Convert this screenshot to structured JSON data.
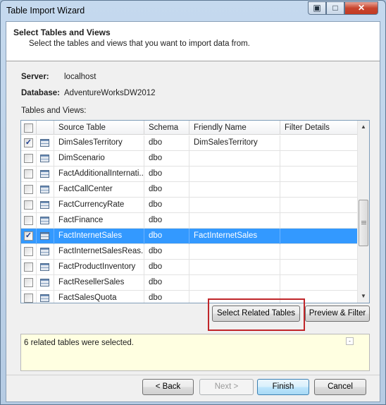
{
  "window": {
    "title": "Table Import Wizard",
    "controls": {
      "help": "▣",
      "maximize": "□",
      "close": "✕"
    }
  },
  "header": {
    "title": "Select Tables and Views",
    "subtitle": "Select the tables and views that you want to import data from."
  },
  "info": {
    "server_label": "Server:",
    "server_value": "localhost",
    "database_label": "Database:",
    "database_value": "AdventureWorksDW2012",
    "tables_label": "Tables and Views:"
  },
  "grid": {
    "columns": [
      "",
      "",
      "Source Table",
      "Schema",
      "Friendly Name",
      "Filter Details"
    ],
    "rows": [
      {
        "checked": true,
        "source": "DimSalesTerritory",
        "schema": "dbo",
        "friendly": "DimSalesTerritory",
        "filter": "",
        "selected": false
      },
      {
        "checked": false,
        "source": "DimScenario",
        "schema": "dbo",
        "friendly": "",
        "filter": "",
        "selected": false
      },
      {
        "checked": false,
        "source": "FactAdditionalInternati...",
        "schema": "dbo",
        "friendly": "",
        "filter": "",
        "selected": false
      },
      {
        "checked": false,
        "source": "FactCallCenter",
        "schema": "dbo",
        "friendly": "",
        "filter": "",
        "selected": false
      },
      {
        "checked": false,
        "source": "FactCurrencyRate",
        "schema": "dbo",
        "friendly": "",
        "filter": "",
        "selected": false
      },
      {
        "checked": false,
        "source": "FactFinance",
        "schema": "dbo",
        "friendly": "",
        "filter": "",
        "selected": false
      },
      {
        "checked": true,
        "source": "FactInternetSales",
        "schema": "dbo",
        "friendly": "FactInternetSales",
        "filter": "",
        "selected": true
      },
      {
        "checked": false,
        "source": "FactInternetSalesReas...",
        "schema": "dbo",
        "friendly": "",
        "filter": "",
        "selected": false
      },
      {
        "checked": false,
        "source": "FactProductInventory",
        "schema": "dbo",
        "friendly": "",
        "filter": "",
        "selected": false
      },
      {
        "checked": false,
        "source": "FactResellerSales",
        "schema": "dbo",
        "friendly": "",
        "filter": "",
        "selected": false
      },
      {
        "checked": false,
        "source": "FactSalesQuota",
        "schema": "dbo",
        "friendly": "",
        "filter": "",
        "selected": false
      }
    ],
    "scroll": {
      "up": "▲",
      "down": "▼"
    }
  },
  "actions": {
    "select_related": "Select Related Tables",
    "preview_filter": "Preview & Filter"
  },
  "status": {
    "message": "6 related tables were selected.",
    "scroll_glyph": "-"
  },
  "footer": {
    "back": "< Back",
    "next": "Next >",
    "finish": "Finish",
    "cancel": "Cancel"
  }
}
